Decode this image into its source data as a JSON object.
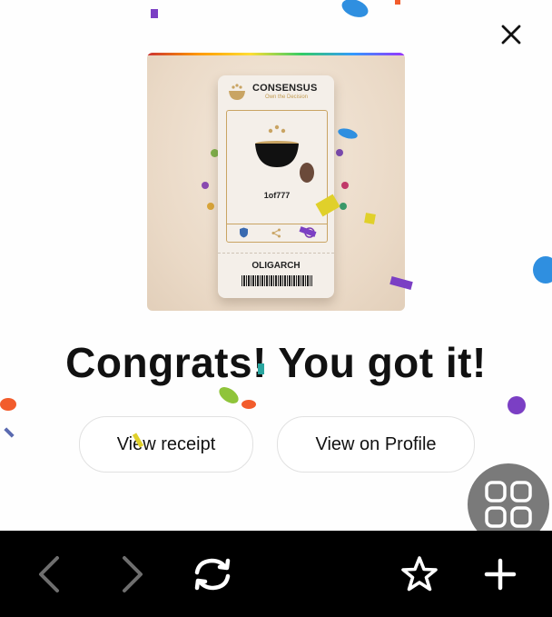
{
  "dialog": {
    "close_icon": "close-icon",
    "ticket": {
      "brand": "CONSENSUS",
      "tagline": "Own the Decision",
      "serial": "1of777",
      "stub_title": "OLIGARCH"
    },
    "headline": "Congrats! You got it!",
    "buttons": {
      "view_receipt": "View receipt",
      "view_profile": "View on Profile"
    }
  },
  "floating_button": {
    "icon": "apps-grid-icon"
  },
  "browser_bar": {
    "back_icon": "chevron-left-icon",
    "forward_icon": "chevron-right-icon",
    "refresh_icon": "refresh-icon",
    "bookmark_icon": "star-icon",
    "new_tab_icon": "plus-icon"
  },
  "colors": {
    "bar_background": "#000000",
    "fab_background": "#7a7a7a",
    "confetti": [
      "#2f8fe0",
      "#f25c2c",
      "#7b3fc4",
      "#8fc43a",
      "#e0d02a",
      "#2aa6a0"
    ]
  }
}
